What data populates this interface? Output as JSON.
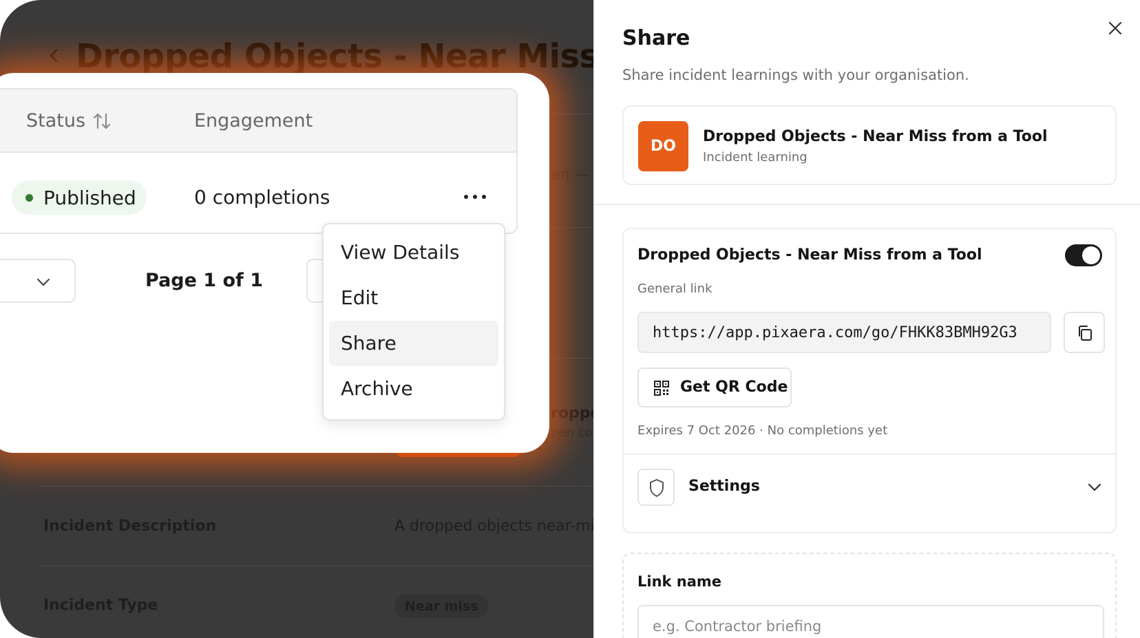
{
  "background": {
    "page_title": "Dropped Objects - Near Miss from",
    "partial_texts": [
      "en —",
      "roppe",
      "pen cou"
    ],
    "incident_description_label": "Incident Description",
    "incident_description_value": "A dropped objects near-mis",
    "incident_type_label": "Incident Type",
    "incident_type_value": "Near miss"
  },
  "table": {
    "columns": [
      "Status",
      "Engagement"
    ],
    "row": {
      "status": "Published",
      "engagement": "0 completions"
    },
    "status_color": "#2f7d32"
  },
  "pagination": {
    "text": "Page 1 of 1"
  },
  "row_menu": {
    "items": [
      "View Details",
      "Edit",
      "Share",
      "Archive"
    ],
    "active": "Share"
  },
  "share_panel": {
    "title": "Share",
    "subtitle": "Share incident learnings with your organisation.",
    "item": {
      "avatar_initials": "DO",
      "avatar_color": "#e85d17",
      "title": "Dropped Objects - Near Miss from a Tool",
      "type": "Incident learning"
    },
    "link": {
      "title": "Dropped Objects - Near Miss from a Tool",
      "enabled": true,
      "label": "General link",
      "url": "https://app.pixaera.com/go/FHKK83BMH92G3",
      "qr_button": "Get QR Code",
      "meta": "Expires 7 Oct 2026 · No completions yet"
    },
    "settings_label": "Settings",
    "link_name": {
      "label": "Link name",
      "placeholder": "e.g. Contractor briefing"
    }
  },
  "colors": {
    "accent_glow": "#e85c16",
    "backdrop": "#3a3a3a",
    "toggle_on": "#1b1b1b"
  }
}
